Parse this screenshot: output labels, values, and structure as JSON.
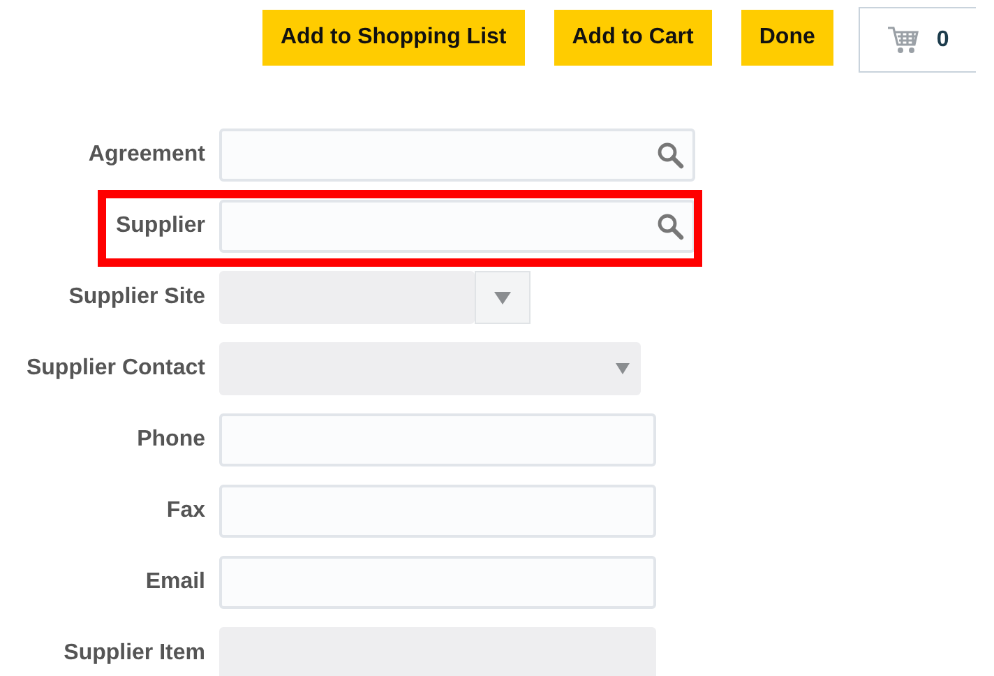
{
  "toolbar": {
    "buttons": [
      "Add to Shopping List",
      "Add to Cart",
      "Done"
    ],
    "cart_count": "0"
  },
  "fields": [
    {
      "label": "Agreement",
      "kind": "search",
      "disabled": false,
      "highlighted": false
    },
    {
      "label": "Supplier",
      "kind": "search",
      "disabled": false,
      "highlighted": true
    },
    {
      "label": "Supplier Site",
      "kind": "choice",
      "disabled": true,
      "highlighted": false
    },
    {
      "label": "Supplier Contact",
      "kind": "select",
      "disabled": true,
      "highlighted": false
    },
    {
      "label": "Phone",
      "kind": "text",
      "disabled": false,
      "highlighted": false
    },
    {
      "label": "Fax",
      "kind": "text",
      "disabled": false,
      "highlighted": false
    },
    {
      "label": "Email",
      "kind": "text",
      "disabled": false,
      "highlighted": false
    },
    {
      "label": "Supplier Item",
      "kind": "text",
      "disabled": true,
      "highlighted": false
    }
  ]
}
